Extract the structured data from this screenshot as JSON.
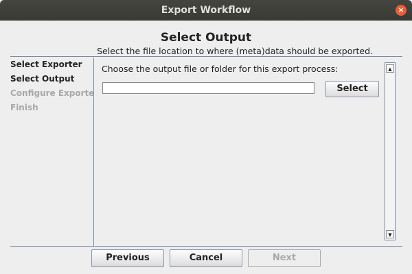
{
  "window": {
    "title": "Export Workflow",
    "close_icon": "×"
  },
  "header": {
    "title": "Select Output",
    "subtitle": "Select the file location to where (meta)data should be exported."
  },
  "steps": [
    {
      "label": "Select Exporter",
      "state": "done"
    },
    {
      "label": "Select Output",
      "state": "active"
    },
    {
      "label": "Configure Exporter",
      "state": "disabled"
    },
    {
      "label": "Finish",
      "state": "disabled"
    }
  ],
  "content": {
    "prompt": "Choose the output file or folder for this export process:",
    "path_value": "",
    "select_label": "Select"
  },
  "footer": {
    "previous_label": "Previous",
    "cancel_label": "Cancel",
    "next_label": "Next"
  },
  "scroll": {
    "up_icon": "▲",
    "down_icon": "▼"
  }
}
